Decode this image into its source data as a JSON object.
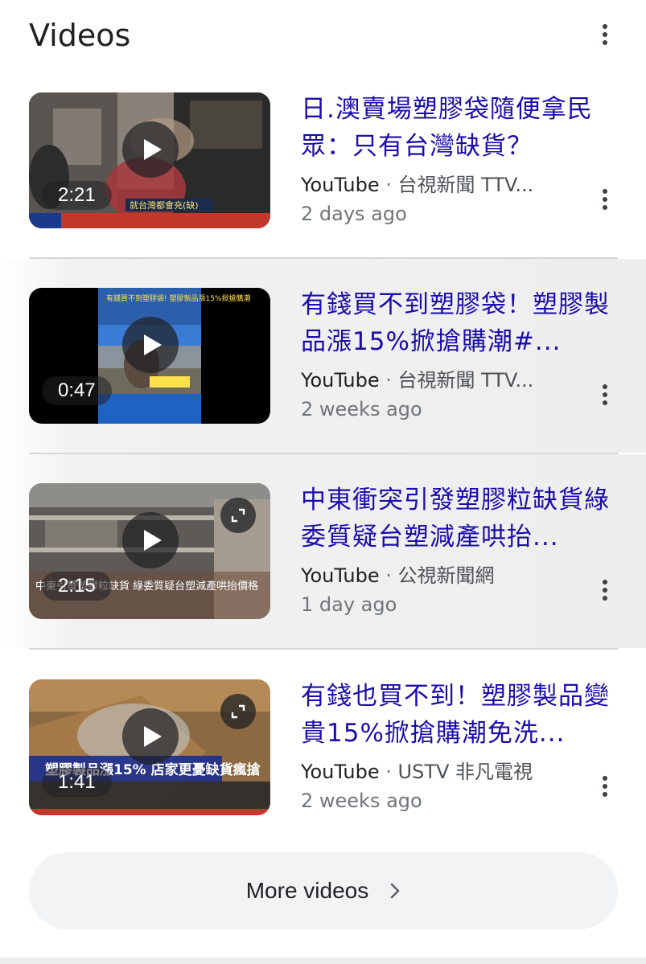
{
  "header": {
    "title": "Videos",
    "menu_icon": "more-vert-icon"
  },
  "videos": [
    {
      "title": "日.澳賣場塑膠袋隨便拿民眾：只有台灣缺貨？",
      "platform": "YouTube",
      "separator": "·",
      "channel": "台視新聞 TTV...",
      "age": "2 days ago",
      "duration": "2:21",
      "has_expand": false,
      "thumbnail": {
        "overlay_text": "就台灣都會充(缺)",
        "palette": [
          "#4a4542",
          "#8a7b6f",
          "#c0392b"
        ]
      }
    },
    {
      "title": "有錢買不到塑膠袋！塑膠製品漲15%掀搶購潮#...",
      "platform": "YouTube",
      "separator": "·",
      "channel": "台視新聞 TTV...",
      "age": "2 weeks ago",
      "duration": "0:47",
      "has_expand": false,
      "thumbnail": {
        "overlay_text": "有錢買不到塑膠袋! 塑膠製品漲15%掀搶購潮",
        "palette": [
          "#000000",
          "#3a7bd5",
          "#ffe14d"
        ]
      }
    },
    {
      "title": "中東衝突引發塑膠粒缺貨綠委質疑台塑減產哄抬...",
      "platform": "YouTube",
      "separator": "·",
      "channel": "公視新聞網",
      "age": "1 day ago",
      "duration": "2:15",
      "has_expand": true,
      "thumbnail": {
        "overlay_text": "中東引發塑膠粒缺貨 綠委質疑台塑減產哄抬價格",
        "palette": [
          "#6b6b6b",
          "#a39a8f",
          "#ffffff"
        ]
      }
    },
    {
      "title": "有錢也買不到！塑膠製品變貴15%掀搶購潮免洗...",
      "platform": "YouTube",
      "separator": "·",
      "channel": "USTV 非凡電視",
      "age": "2 weeks ago",
      "duration": "1:41",
      "has_expand": true,
      "thumbnail": {
        "overlay_text": "塑膠製品漲15% 店家更憂缺貨瘋搶",
        "palette": [
          "#8b6a43",
          "#1e2f8c",
          "#ffd43b"
        ]
      }
    }
  ],
  "more_button": {
    "label": "More videos",
    "icon": "chevron-right-icon"
  },
  "colors": {
    "link": "#1a0dab",
    "text": "#202124",
    "secondary": "#70757a",
    "button_bg": "#f1f3f4"
  }
}
